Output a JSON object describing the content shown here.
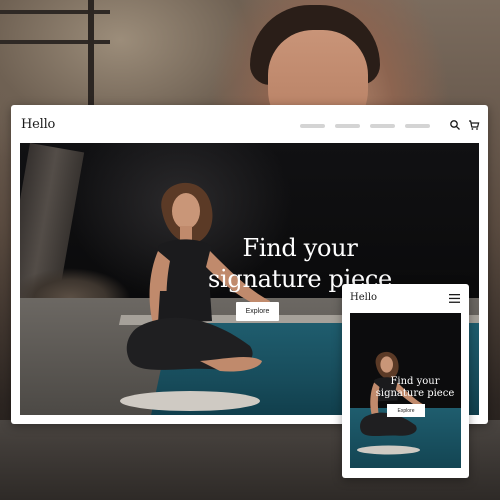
{
  "desktop": {
    "logo": "Hello",
    "nav_items": [
      "",
      "",
      "",
      ""
    ],
    "icons": [
      "search-icon",
      "cart-icon"
    ],
    "hero": {
      "headline_line1": "Find your",
      "headline_line2": "signature piece",
      "button_label": "Explore"
    }
  },
  "mobile": {
    "logo": "Hello",
    "icons": [
      "menu-icon"
    ],
    "hero": {
      "headline_line1": "Find your",
      "headline_line2": "signature piece",
      "button_label": "Explore"
    }
  },
  "colors": {
    "page_bg": "#ffffff",
    "text": "#1a1a1a",
    "nav_placeholder": "#d4d4d4",
    "button_bg": "#ffffff",
    "pool": "#1f5d6e"
  }
}
